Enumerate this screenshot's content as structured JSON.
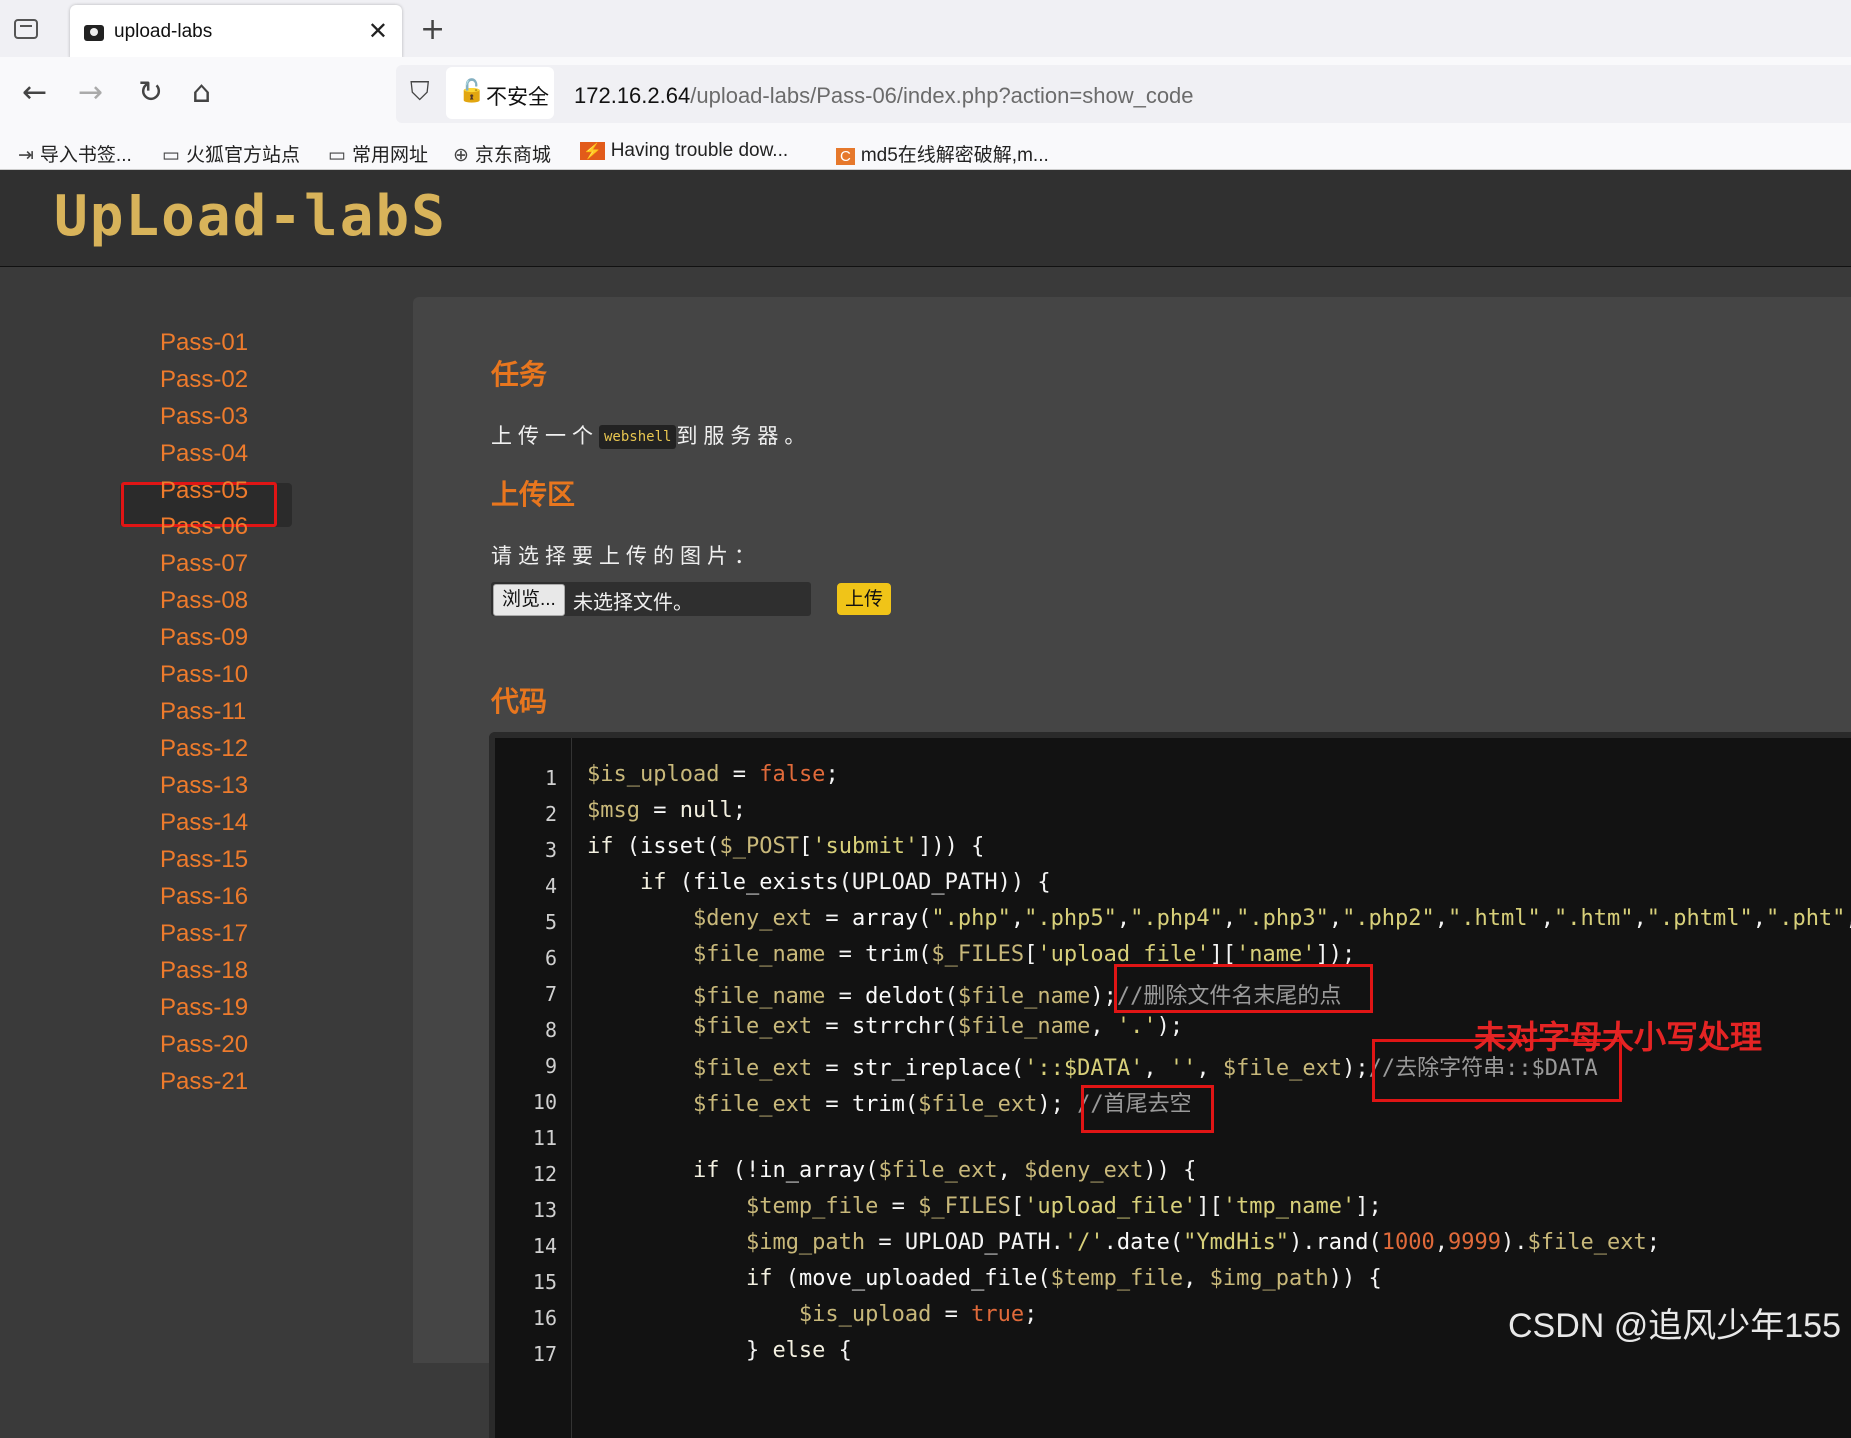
{
  "browser": {
    "tab_title": "upload-labs",
    "tab_close": "✕",
    "new_tab": "+",
    "back": "←",
    "forward": "→",
    "reload": "↻",
    "home": "⌂",
    "insecure_label": "不安全",
    "url_host": "172.16.2.64",
    "url_path": "/upload-labs/Pass-06/index.php?action=show_code",
    "bookmarks": [
      {
        "icon": "import-icon",
        "label": "导入书签..."
      },
      {
        "icon": "folder-icon",
        "label": "火狐官方站点"
      },
      {
        "icon": "folder-icon",
        "label": "常用网址"
      },
      {
        "icon": "globe-icon",
        "label": "京东商城"
      },
      {
        "icon": "firefox-icon",
        "label": "Having trouble dow..."
      },
      {
        "icon": "md5-site-icon",
        "label": "md5在线解密破解,m..."
      }
    ]
  },
  "site": {
    "logo": "UpLoad-labS"
  },
  "sidebar": {
    "items": [
      "Pass-01",
      "Pass-02",
      "Pass-03",
      "Pass-04",
      "Pass-05",
      "Pass-06",
      "Pass-07",
      "Pass-08",
      "Pass-09",
      "Pass-10",
      "Pass-11",
      "Pass-12",
      "Pass-13",
      "Pass-14",
      "Pass-15",
      "Pass-16",
      "Pass-17",
      "Pass-18",
      "Pass-19",
      "Pass-20",
      "Pass-21"
    ],
    "active": "Pass-06"
  },
  "main": {
    "task_title": "任务",
    "task_pre": "上传一个",
    "task_code": "webshell",
    "task_post": "到服务器。",
    "upload_title": "上传区",
    "upload_prompt": "请选择要上传的图片：",
    "browse_label": "浏览...",
    "file_status": "未选择文件。",
    "upload_button": "上传",
    "code_title": "代码"
  },
  "code": {
    "line_numbers": [
      "1",
      "2",
      "3",
      "4",
      "5",
      "6",
      "7",
      "8",
      "9",
      "10",
      "11",
      "12",
      "13",
      "14",
      "15",
      "16",
      "17"
    ],
    "comment_7": "//删除文件名末尾的点",
    "comment_9": "//去除字符串::$DATA",
    "comment_10": "//首尾去空"
  },
  "annotation": "未对字母大小写处理",
  "watermark": "CSDN @追风少年155"
}
